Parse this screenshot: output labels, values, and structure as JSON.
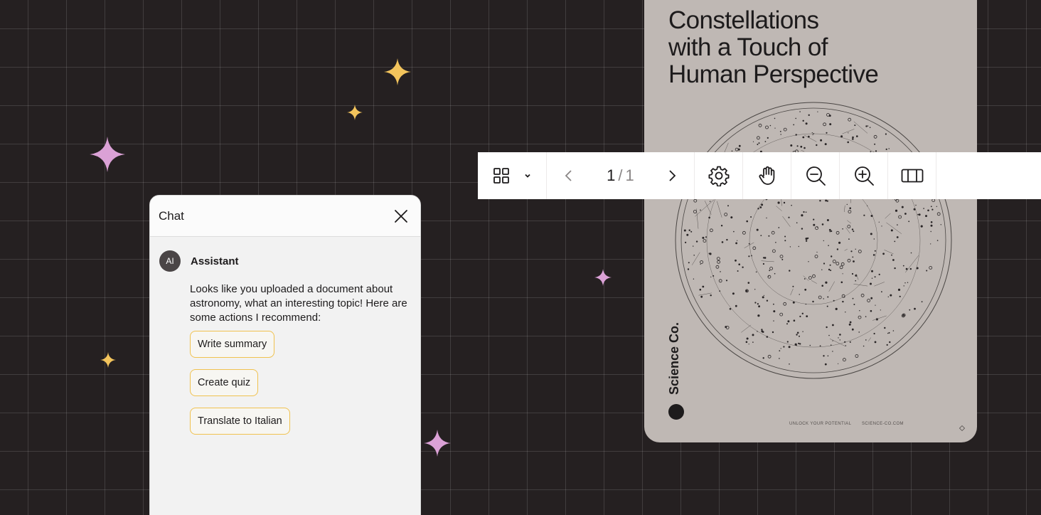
{
  "colors": {
    "background": "#252021",
    "gold_sparkle": "#f3c45c",
    "pink_sparkle": "#dba1d6",
    "action_border": "#f0c24f",
    "page": "#bfb8b4"
  },
  "document": {
    "title_lines": [
      "Constellations",
      "with a Touch of",
      "Human Perspective"
    ],
    "brand": "Science Co.",
    "footer_left": "UNLOCK YOUR POTENTIAL",
    "footer_right": "SCIENCE-CO.COM"
  },
  "toolbar": {
    "icons": [
      "grid-view-icon",
      "chevron-down-icon",
      "previous-page-icon",
      "next-page-icon",
      "settings-icon",
      "pan-hand-icon",
      "zoom-out-icon",
      "zoom-in-icon",
      "layout-columns-icon"
    ],
    "current_page": "1",
    "separator": "/",
    "total_pages": "1"
  },
  "chat": {
    "title": "Chat",
    "sender_avatar": "AI",
    "sender_name": "Assistant",
    "message": "Looks like you uploaded a document about astronomy, what an interesting topic! Here are some actions I recommend:",
    "actions": [
      "Write summary",
      "Create quiz",
      "Translate to Italian"
    ]
  }
}
